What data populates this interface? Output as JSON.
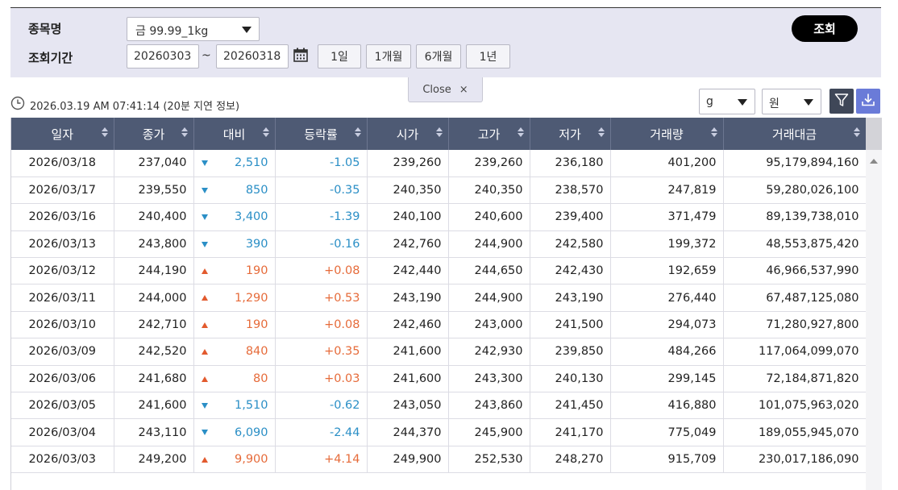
{
  "search": {
    "item_label": "종목명",
    "period_label": "조회기간",
    "item_selected": "금 99.99_1kg",
    "date_from": "20260303",
    "date_sep": "~",
    "date_to": "20260318",
    "period_buttons": [
      "1일",
      "1개월",
      "6개월",
      "1년"
    ],
    "query_button": "조회",
    "close_label": "Close",
    "close_icon": "×"
  },
  "status": {
    "timestamp": "2026.03.19 AM 07:41:14 (20분 지연 정보)"
  },
  "units": {
    "weight": "g",
    "currency": "원"
  },
  "table": {
    "headers": [
      "일자",
      "종가",
      "대비",
      "등락률",
      "시가",
      "고가",
      "저가",
      "거래량",
      "거래대금"
    ],
    "rows": [
      {
        "date": "2026/03/18",
        "close": "237,040",
        "dir": "down",
        "change": "2,510",
        "rate": "-1.05",
        "open": "239,260",
        "high": "239,260",
        "low": "236,180",
        "volume": "401,200",
        "amount": "95,179,894,160"
      },
      {
        "date": "2026/03/17",
        "close": "239,550",
        "dir": "down",
        "change": "850",
        "rate": "-0.35",
        "open": "240,350",
        "high": "240,350",
        "low": "238,570",
        "volume": "247,819",
        "amount": "59,280,026,100"
      },
      {
        "date": "2026/03/16",
        "close": "240,400",
        "dir": "down",
        "change": "3,400",
        "rate": "-1.39",
        "open": "240,100",
        "high": "240,600",
        "low": "239,400",
        "volume": "371,479",
        "amount": "89,139,738,010"
      },
      {
        "date": "2026/03/13",
        "close": "243,800",
        "dir": "down",
        "change": "390",
        "rate": "-0.16",
        "open": "242,760",
        "high": "244,900",
        "low": "242,580",
        "volume": "199,372",
        "amount": "48,553,875,420"
      },
      {
        "date": "2026/03/12",
        "close": "244,190",
        "dir": "up",
        "change": "190",
        "rate": "+0.08",
        "open": "242,440",
        "high": "244,650",
        "low": "242,430",
        "volume": "192,659",
        "amount": "46,966,537,990"
      },
      {
        "date": "2026/03/11",
        "close": "244,000",
        "dir": "up",
        "change": "1,290",
        "rate": "+0.53",
        "open": "243,190",
        "high": "244,900",
        "low": "243,190",
        "volume": "276,440",
        "amount": "67,487,125,080"
      },
      {
        "date": "2026/03/10",
        "close": "242,710",
        "dir": "up",
        "change": "190",
        "rate": "+0.08",
        "open": "242,460",
        "high": "243,000",
        "low": "241,500",
        "volume": "294,073",
        "amount": "71,280,927,800"
      },
      {
        "date": "2026/03/09",
        "close": "242,520",
        "dir": "up",
        "change": "840",
        "rate": "+0.35",
        "open": "241,600",
        "high": "242,930",
        "low": "239,850",
        "volume": "484,266",
        "amount": "117,064,099,070"
      },
      {
        "date": "2026/03/06",
        "close": "241,680",
        "dir": "up",
        "change": "80",
        "rate": "+0.03",
        "open": "241,600",
        "high": "243,300",
        "low": "240,130",
        "volume": "299,145",
        "amount": "72,184,871,820"
      },
      {
        "date": "2026/03/05",
        "close": "241,600",
        "dir": "down",
        "change": "1,510",
        "rate": "-0.62",
        "open": "243,050",
        "high": "243,860",
        "low": "241,450",
        "volume": "416,880",
        "amount": "101,075,963,020"
      },
      {
        "date": "2026/03/04",
        "close": "243,110",
        "dir": "down",
        "change": "6,090",
        "rate": "-2.44",
        "open": "244,370",
        "high": "245,900",
        "low": "241,170",
        "volume": "775,049",
        "amount": "189,055,945,070"
      },
      {
        "date": "2026/03/03",
        "close": "249,200",
        "dir": "up",
        "change": "9,900",
        "rate": "+4.14",
        "open": "249,900",
        "high": "252,530",
        "low": "248,270",
        "volume": "915,709",
        "amount": "230,017,186,090"
      }
    ]
  },
  "colors": {
    "header_bg": "#4e5a74",
    "down": "#2b8fc6",
    "up": "#e66b3a",
    "panel_bg": "#e6e6f2",
    "download_btn": "#6a7bd8"
  },
  "icons": {
    "calendar": "calendar-icon",
    "clock": "clock-icon",
    "filter": "filter-icon",
    "download": "download-icon"
  }
}
